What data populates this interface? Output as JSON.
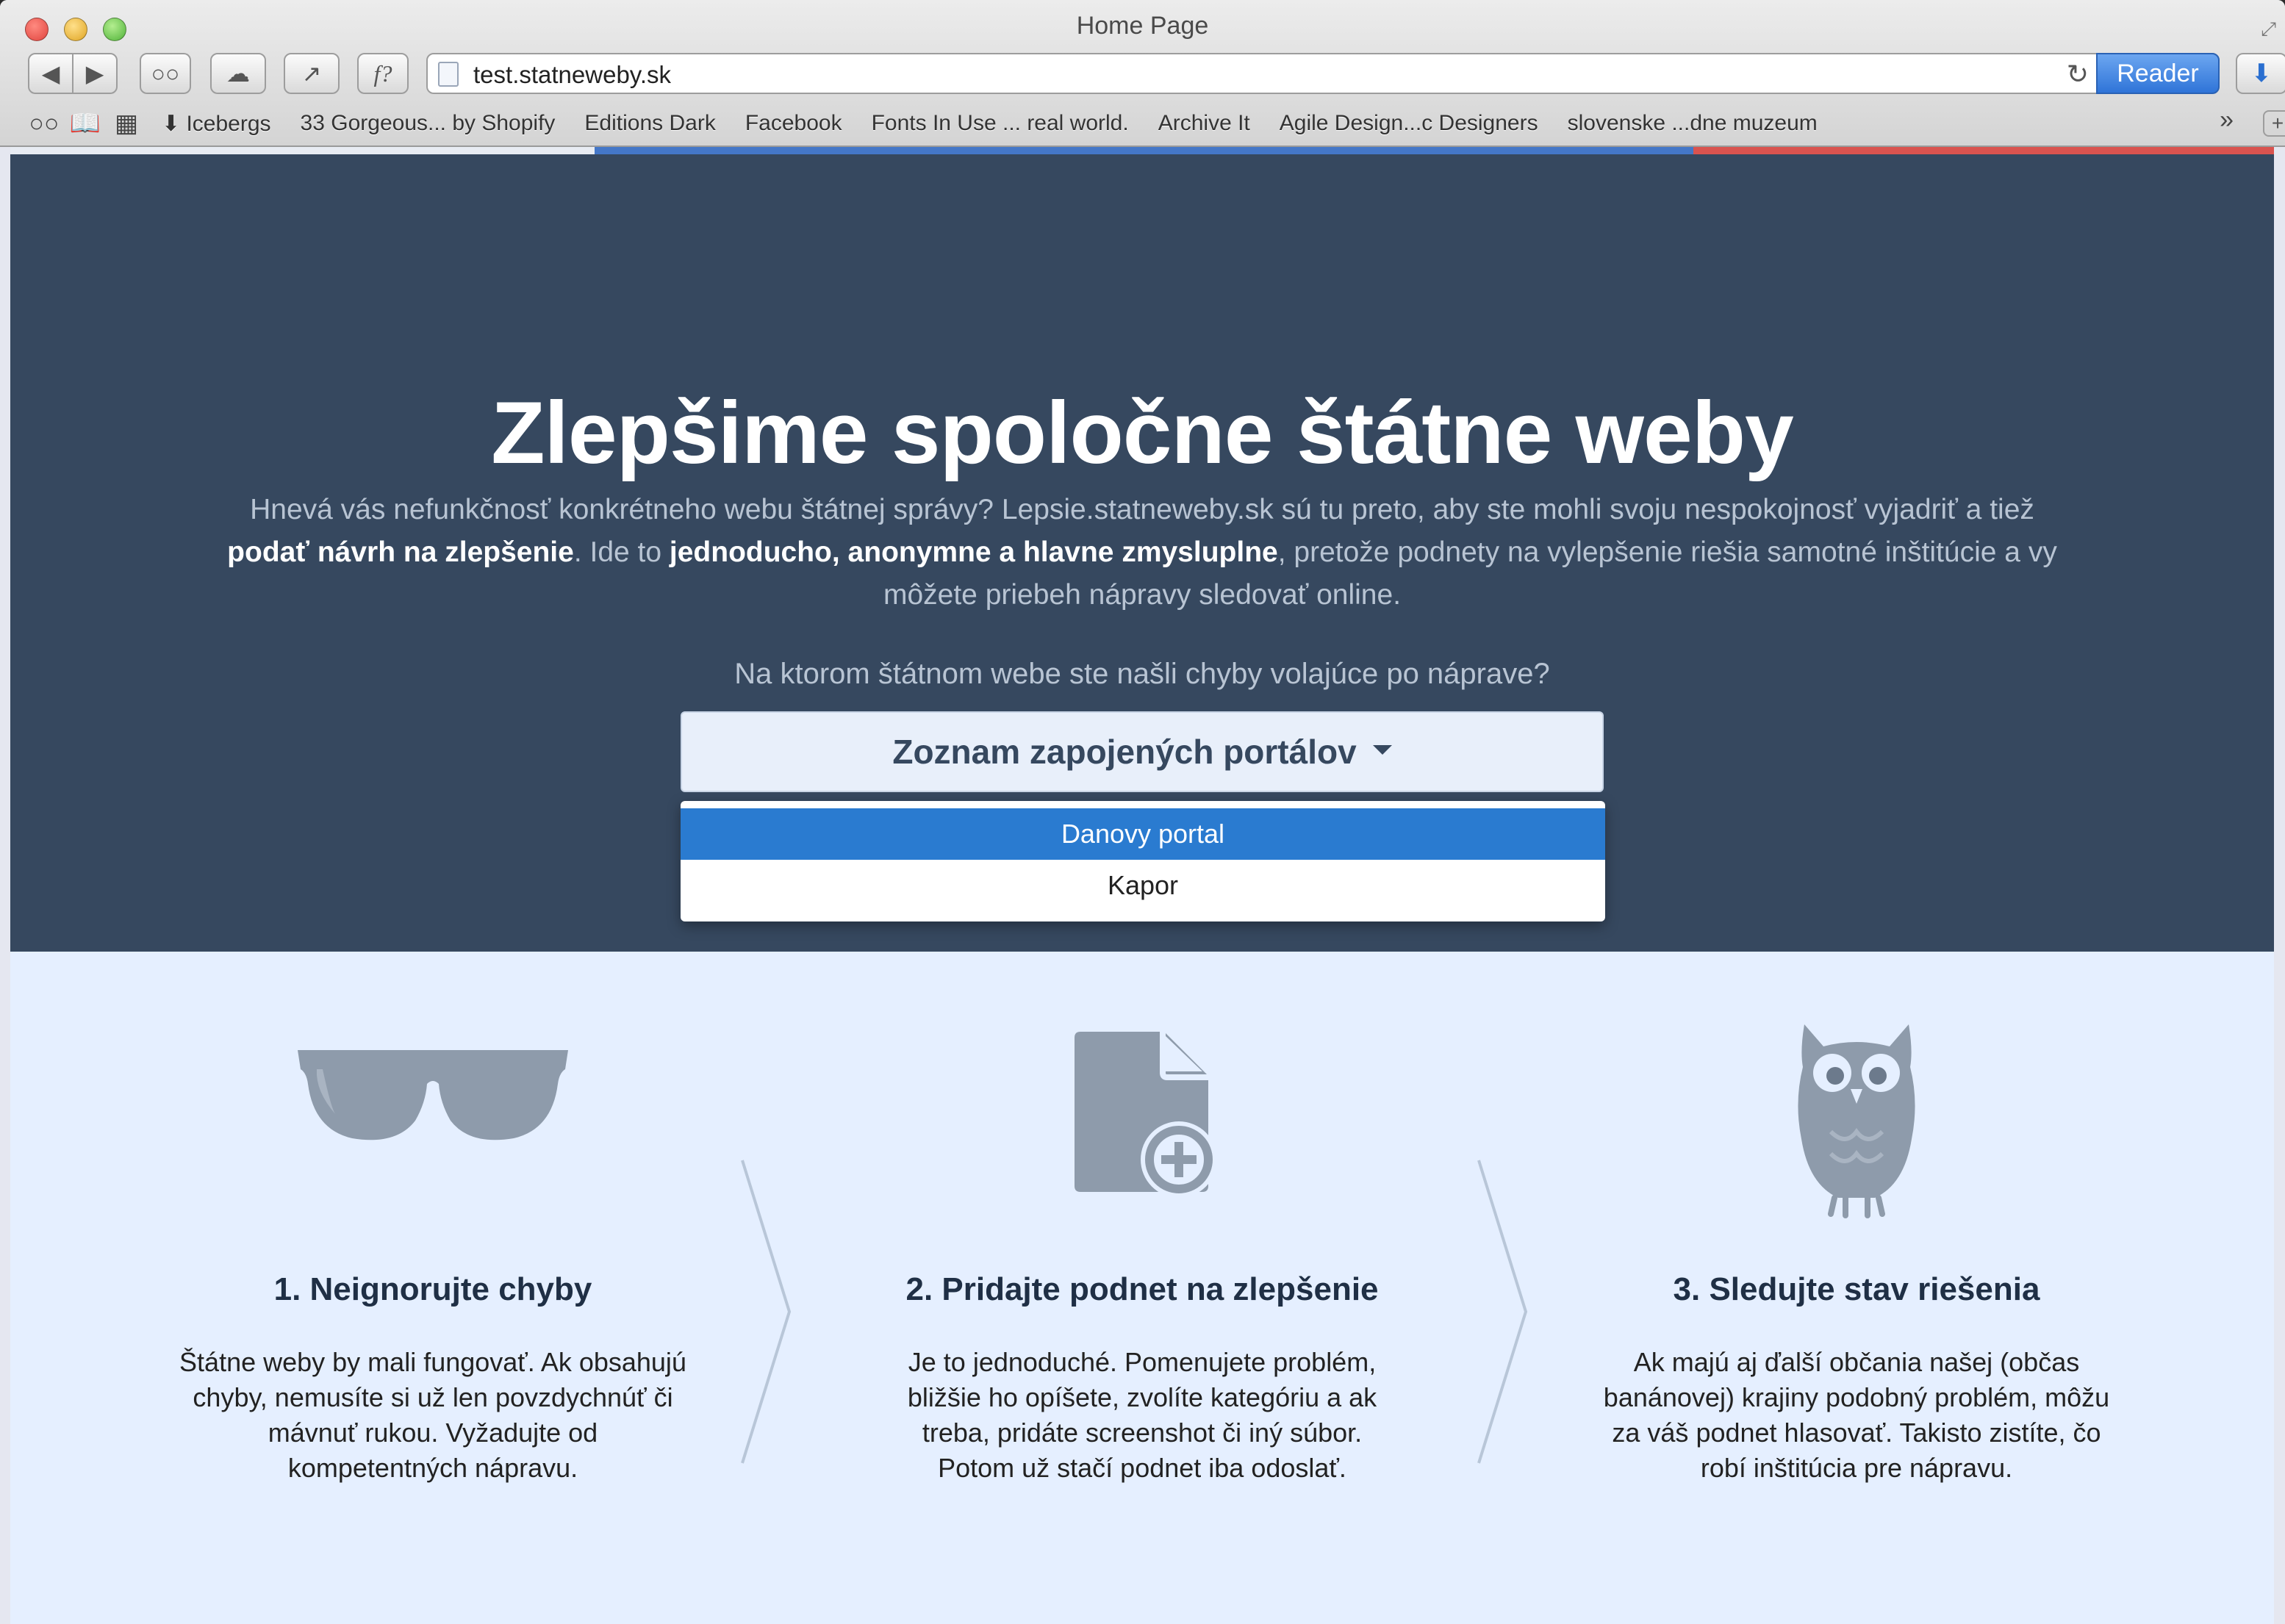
{
  "window": {
    "title": "Home Page",
    "url": "test.statneweby.sk",
    "reader_label": "Reader"
  },
  "bookmarks": [
    "⬇ Icebergs",
    "33 Gorgeous... by Shopify",
    "Editions Dark",
    "Facebook",
    "Fonts In Use ... real world.",
    "Archive It",
    "Agile Design...c Designers",
    "slovenske ...dne muzeum"
  ],
  "hero": {
    "title": "Zlepšime spoločne štátne weby",
    "desc_part1": "Hnevá vás nefunkčnosť konkrétneho webu štátnej správy? Lepsie.statneweby.sk sú tu preto, aby ste mohli svoju nespokojnosť vyjadriť a tiež ",
    "desc_bold1": "podať návrh na zlepšenie",
    "desc_part2": ". Ide to ",
    "desc_bold2": "jednoducho, anonymne a hlavne zmysluplne",
    "desc_part3": ", pretože podnety na vylepšenie riešia samotné inštitúcie a vy môžete priebeh nápravy sledovať online.",
    "question": "Na ktorom štátnom webe ste našli chyby volajúce po náprave?",
    "dropdown_label": "Zoznam zapojených portálov",
    "dropdown_options": [
      "Danovy portal",
      "Kapor"
    ]
  },
  "steps": [
    {
      "title": "1. Neignorujte chyby",
      "text": "Štátne weby by mali fungovať. Ak obsahujú chyby, nemusíte si už len povzdychnúť či mávnuť rukou. Vyžadujte od kompetentných nápravu."
    },
    {
      "title": "2. Pridajte podnet na zlepšenie",
      "text": "Je to jednoduché. Pomenujete problém, bližšie ho opíšete, zvolíte kategóriu a ak treba, pridáte screenshot či iný súbor. Potom už stačí podnet iba odoslať."
    },
    {
      "title": "3. Sledujte stav riešenia",
      "text": "Ak majú aj ďalší občania našej (občas banánovej) krajiny podobný problém, môžu za váš podnet hlasovať. Takisto zistíte, čo robí inštitúcia pre nápravu."
    }
  ],
  "colors": {
    "hero_bg": "#36485f",
    "steps_bg": "#e5efff",
    "icon_gray": "#8e9bab",
    "accent_blue": "#2a7bd0"
  },
  "icons": [
    "sunglasses-icon",
    "add-document-icon",
    "owl-icon",
    "chevron-right-icon"
  ]
}
